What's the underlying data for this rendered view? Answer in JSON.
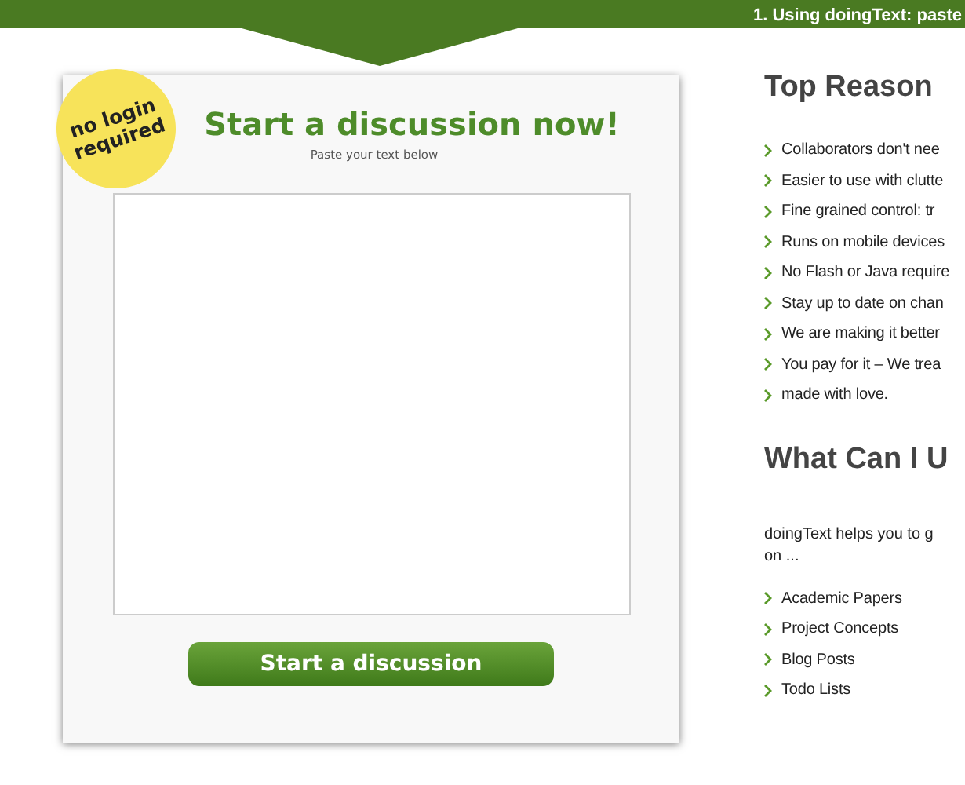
{
  "top_bar": {
    "text": "1. Using doingText: paste"
  },
  "card": {
    "sticker": "no login required",
    "title": "Start a discussion now!",
    "subtitle": "Paste your text below",
    "button": "Start a discussion"
  },
  "sections": [
    {
      "heading": "Top Reason",
      "items": [
        "Collaborators don't nee",
        "Easier to use with clutte",
        "Fine grained control: tr",
        "Runs on mobile devices",
        "No Flash or Java require",
        "Stay up to date on chan",
        "We are making it better",
        "You pay for it – We trea",
        "made with love."
      ]
    },
    {
      "heading": "What Can I U",
      "paragraph_lines": [
        "doingText helps you to g",
        "on ..."
      ],
      "items": [
        "Academic Papers",
        "Project Concepts",
        "Blog Posts",
        "Todo Lists"
      ]
    }
  ]
}
